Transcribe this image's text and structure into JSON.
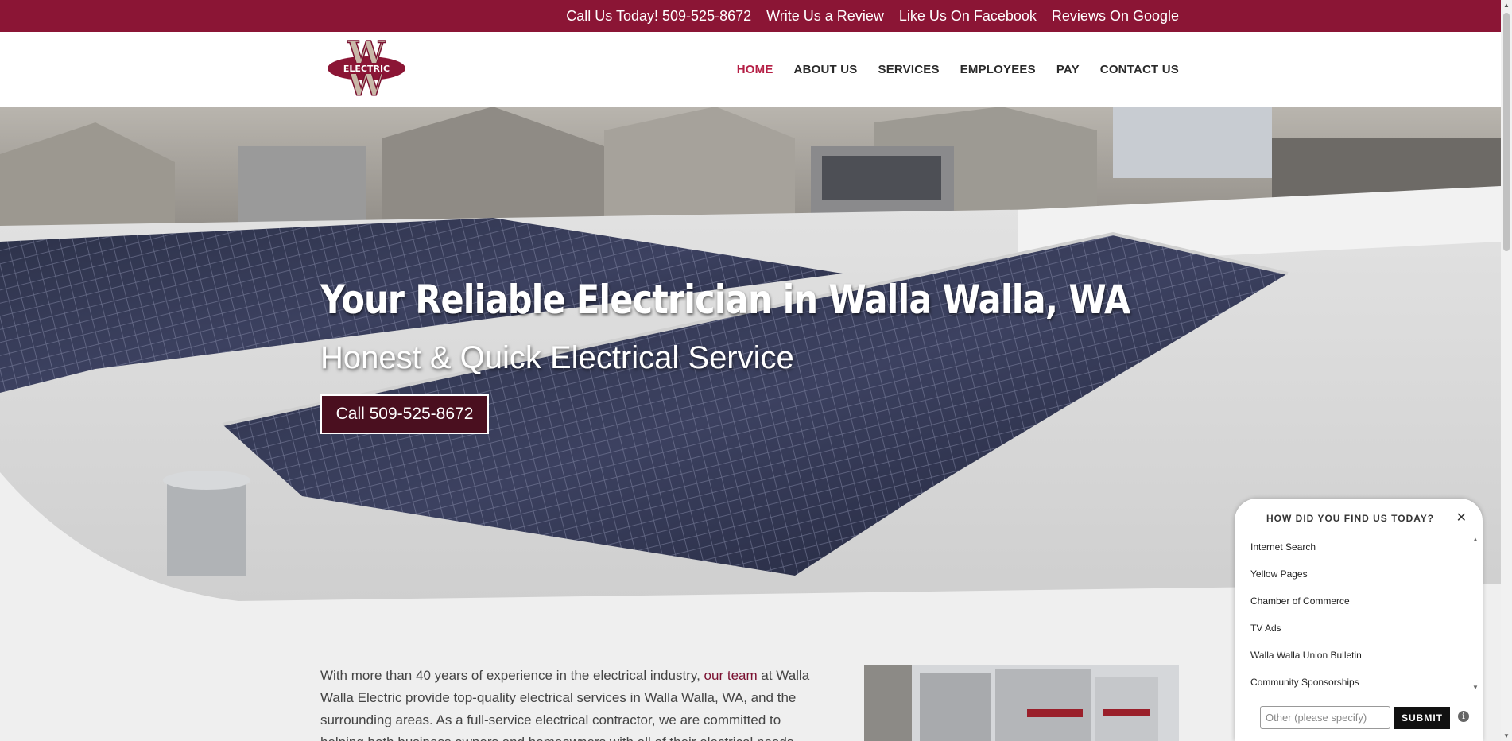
{
  "topbar": {
    "links": [
      "Call Us Today! 509-525-8672",
      "Write Us a Review",
      "Like Us On Facebook",
      "Reviews On Google"
    ]
  },
  "header": {
    "logo_text": "ELECTRIC",
    "nav": [
      "HOME",
      "ABOUT US",
      "SERVICES",
      "EMPLOYEES",
      "PAY",
      "CONTACT US"
    ],
    "active": "HOME"
  },
  "hero": {
    "title": "Your Reliable Electrician in Walla Walla, WA",
    "subtitle": "Honest & Quick Electrical Service",
    "button": "Call 509-525-8672"
  },
  "content": {
    "p_before": "With more than 40 years of experience in the electrical industry,",
    "link": "our team",
    "p_after": "at Walla Walla Electric provide top-quality electrical services in Walla Walla, WA, and the surrounding areas. As a full-service electrical contractor, we are committed to helping both business owners and homeowners with all of their electrical needs."
  },
  "survey": {
    "title": "HOW DID YOU FIND US TODAY?",
    "options": [
      "Internet Search",
      "Yellow Pages",
      "Chamber of Commerce",
      "TV Ads",
      "Walla Walla Union Bulletin",
      "Community Sponsorships"
    ],
    "other_placeholder": "Other (please specify)",
    "submit": "SUBMIT"
  },
  "colors": {
    "brand": "#8b1535",
    "button": "#4a0f1f",
    "active_nav": "#b51f45"
  }
}
